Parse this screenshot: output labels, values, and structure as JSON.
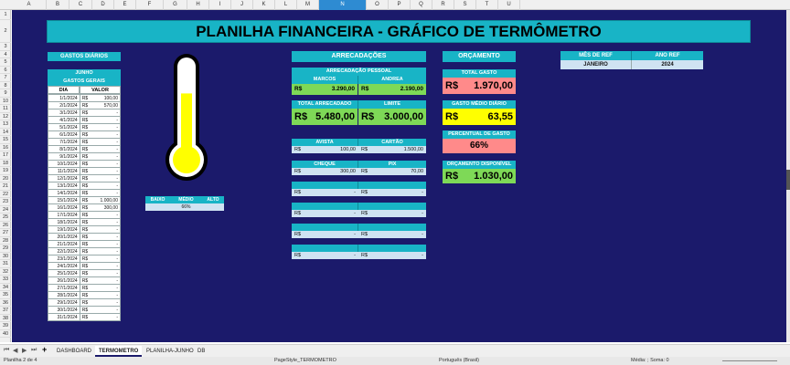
{
  "columns": [
    "A",
    "B",
    "C",
    "D",
    "E",
    "F",
    "G",
    "H",
    "I",
    "J",
    "K",
    "L",
    "M",
    "N",
    "O",
    "P",
    "Q",
    "R",
    "S",
    "T",
    "U"
  ],
  "selected_column": "N",
  "rows": [
    "1",
    "2",
    "3",
    "4",
    "5",
    "6",
    "7",
    "8",
    "9",
    "10",
    "11",
    "12",
    "13",
    "14",
    "15",
    "16",
    "17",
    "18",
    "19",
    "20",
    "21",
    "22",
    "23",
    "24",
    "25",
    "26",
    "27",
    "28",
    "29",
    "30",
    "31",
    "32",
    "33",
    "34",
    "35",
    "36",
    "37",
    "38",
    "39",
    "40"
  ],
  "title": "PLANILHA FINANCEIRA - GRÁFICO DE TERMÔMETRO",
  "gastos_diarios": {
    "header": "GASTOS DIÁRIOS",
    "month": "JUNHO",
    "subheader": "GASTOS GERAIS",
    "col_dia": "DIA",
    "col_valor": "VALOR",
    "rows": [
      {
        "dia": "1/1/2024",
        "cur": "R$",
        "val": "100,00"
      },
      {
        "dia": "2/1/2024",
        "cur": "R$",
        "val": "570,00"
      },
      {
        "dia": "3/1/2024",
        "cur": "R$",
        "val": "-"
      },
      {
        "dia": "4/1/2024",
        "cur": "R$",
        "val": "-"
      },
      {
        "dia": "5/1/2024",
        "cur": "R$",
        "val": "-"
      },
      {
        "dia": "6/1/2024",
        "cur": "R$",
        "val": "-"
      },
      {
        "dia": "7/1/2024",
        "cur": "R$",
        "val": "-"
      },
      {
        "dia": "8/1/2024",
        "cur": "R$",
        "val": "-"
      },
      {
        "dia": "9/1/2024",
        "cur": "R$",
        "val": "-"
      },
      {
        "dia": "10/1/2024",
        "cur": "R$",
        "val": "-"
      },
      {
        "dia": "11/1/2024",
        "cur": "R$",
        "val": "-"
      },
      {
        "dia": "12/1/2024",
        "cur": "R$",
        "val": "-"
      },
      {
        "dia": "13/1/2024",
        "cur": "R$",
        "val": "-"
      },
      {
        "dia": "14/1/2024",
        "cur": "R$",
        "val": "-"
      },
      {
        "dia": "15/1/2024",
        "cur": "R$",
        "val": "1.000,00"
      },
      {
        "dia": "16/1/2024",
        "cur": "R$",
        "val": "300,00"
      },
      {
        "dia": "17/1/2024",
        "cur": "R$",
        "val": "-"
      },
      {
        "dia": "18/1/2024",
        "cur": "R$",
        "val": "-"
      },
      {
        "dia": "19/1/2024",
        "cur": "R$",
        "val": "-"
      },
      {
        "dia": "20/1/2024",
        "cur": "R$",
        "val": "-"
      },
      {
        "dia": "21/1/2024",
        "cur": "R$",
        "val": "-"
      },
      {
        "dia": "22/1/2024",
        "cur": "R$",
        "val": "-"
      },
      {
        "dia": "23/1/2024",
        "cur": "R$",
        "val": "-"
      },
      {
        "dia": "24/1/2024",
        "cur": "R$",
        "val": "-"
      },
      {
        "dia": "25/1/2024",
        "cur": "R$",
        "val": "-"
      },
      {
        "dia": "26/1/2024",
        "cur": "R$",
        "val": "-"
      },
      {
        "dia": "27/1/2024",
        "cur": "R$",
        "val": "-"
      },
      {
        "dia": "28/1/2024",
        "cur": "R$",
        "val": "-"
      },
      {
        "dia": "29/1/2024",
        "cur": "R$",
        "val": "-"
      },
      {
        "dia": "30/1/2024",
        "cur": "R$",
        "val": "-"
      },
      {
        "dia": "31/1/2024",
        "cur": "R$",
        "val": "-"
      }
    ]
  },
  "thermometer": {
    "fill_fraction": 0.66,
    "colors": {
      "fill": "#ffff00",
      "outline": "#000000",
      "glass": "#ffffff"
    },
    "legend": {
      "baixo": "BAIXO",
      "medio": "MÉDIO",
      "alto": "ALTO",
      "value": "66%"
    }
  },
  "arrecadacoes": {
    "header": "ARRECADAÇÕES",
    "pessoal": "ARRECADAÇÃO PESSOAL",
    "marcos": "MARCOS",
    "andrea": "ANDREA",
    "marcos_cur": "R$",
    "marcos_val": "3.290,00",
    "andrea_cur": "R$",
    "andrea_val": "2.190,00",
    "total_label": "TOTAL ARRECADADO",
    "total_cur": "R$",
    "total_val": "5.480,00",
    "limite_label": "LIMITE",
    "limite_cur": "R$",
    "limite_val": "3.000,00",
    "avista": "AVISTA",
    "cartao": "CARTÃO",
    "avista_cur": "R$",
    "avista_val": "100,00",
    "cartao_cur": "R$",
    "cartao_val": "1.500,00",
    "cheque": "CHEQUE",
    "pix": "PIX",
    "cheque_cur": "R$",
    "cheque_val": "300,00",
    "pix_cur": "R$",
    "pix_val": "70,00",
    "empty_cur": "R$",
    "empty_val": "-"
  },
  "orcamento": {
    "header": "ORÇAMENTO",
    "total_gasto_label": "TOTAL GASTO",
    "total_gasto_cur": "R$",
    "total_gasto_val": "1.970,00",
    "medio_label": "GASTO MÉDIO DIÁRIO",
    "medio_cur": "R$",
    "medio_val": "63,55",
    "percentual_label": "PERCENTUAL DE GASTO",
    "percentual_val": "66%",
    "disponivel_label": "ORÇAMENTO DISPONÍVEL",
    "disponivel_cur": "R$",
    "disponivel_val": "1.030,00"
  },
  "ref": {
    "mes_label": "MÊS DE REF",
    "ano_label": "ANO REF",
    "mes": "JANEIRO",
    "ano": "2024"
  },
  "colors": {
    "background": "#1b1a6b",
    "header_teal": "#18b4c6",
    "green": "#7ed957",
    "red": "#ff8a8a",
    "yellow": "#ffff00"
  },
  "tabs": {
    "items": [
      "DASHBOARD",
      "TERMOMETRO",
      "PLANILHA-JUNHO",
      "DB"
    ],
    "active": "TERMOMETRO",
    "add": "+"
  },
  "status": {
    "sheet": "Planilha 2 de 4",
    "page_style": "PageStyle_TERMOMETRO",
    "language": "Português (Brasil)",
    "formula": "Média: ; Soma: 0"
  }
}
